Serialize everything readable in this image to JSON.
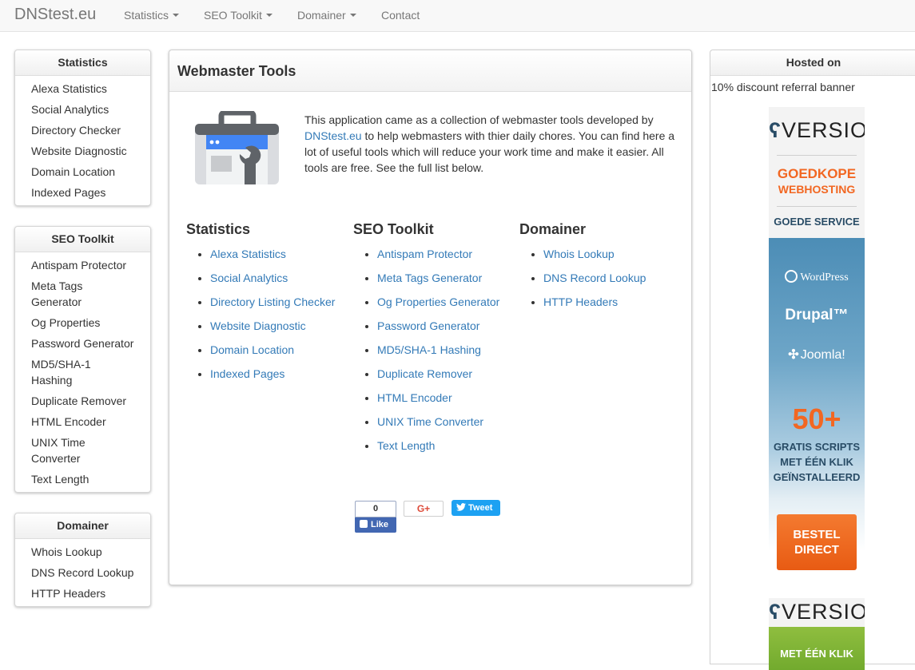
{
  "navbar": {
    "brand": "DNStest.eu",
    "items": [
      {
        "label": "Statistics"
      },
      {
        "label": "SEO Toolkit"
      },
      {
        "label": "Domainer"
      },
      {
        "label": "Contact"
      }
    ]
  },
  "sidebar": {
    "statistics": {
      "title": "Statistics",
      "items": [
        "Alexa Statistics",
        "Social Analytics",
        "Directory Checker",
        "Website Diagnostic",
        "Domain Location",
        "Indexed Pages"
      ]
    },
    "seo": {
      "title": "SEO Toolkit",
      "items": [
        "Antispam Protector",
        "Meta Tags Generator",
        "Og Properties",
        "Password Generator",
        "MD5/SHA-1 Hashing",
        "Duplicate Remover",
        "HTML Encoder",
        "UNIX Time Converter",
        "Text Length"
      ]
    },
    "domainer": {
      "title": "Domainer",
      "items": [
        "Whois Lookup",
        "DNS Record Lookup",
        "HTTP Headers"
      ]
    }
  },
  "main": {
    "title": "Webmaster Tools",
    "intro_before": "This application came as a collection of webmaster tools developed by ",
    "intro_link": "DNStest.eu",
    "intro_after": " to help webmasters with thier daily chores. You can find here a lot of useful tools which will reduce your work time and make it easier. All tools are free. See the full list below.",
    "columns": [
      {
        "title": "Statistics",
        "items": [
          "Alexa Statistics",
          "Social Analytics",
          "Directory Listing Checker",
          "Website Diagnostic",
          "Domain Location",
          "Indexed Pages"
        ]
      },
      {
        "title": "SEO Toolkit",
        "items": [
          "Antispam Protector",
          "Meta Tags Generator",
          "Og Properties Generator",
          "Password Generator",
          "MD5/SHA-1 Hashing",
          "Duplicate Remover",
          "HTML Encoder",
          "UNIX Time Converter",
          "Text Length"
        ]
      },
      {
        "title": "Domainer",
        "items": [
          "Whois Lookup",
          "DNS Record Lookup",
          "HTTP Headers"
        ]
      }
    ],
    "social": {
      "fb_count": "0",
      "fb_like": "Like",
      "gplus": "G+",
      "tweet": "Tweet"
    }
  },
  "hosted": {
    "title": "Hosted on",
    "note": "10% discount referral banner",
    "banner": {
      "logo": "VERSIO",
      "line1": "GOEDKOPE",
      "line2": "WEBHOSTING",
      "service": "GOEDE SERVICE",
      "cms": [
        "WordPress",
        "Drupal™",
        "Joomla!"
      ],
      "big": "50+",
      "scripts": [
        "GRATIS SCRIPTS",
        "MET ÉÉN KLIK",
        "GEÏNSTALLEERD"
      ],
      "button": [
        "BESTEL",
        "DIRECT"
      ]
    },
    "banner2": {
      "logo": "VERSIO",
      "strip": "MET ÉÉN KLIK"
    }
  },
  "colors": {
    "link": "#337ab7",
    "accent_orange": "#f26722",
    "banner_blue": "#4c8db6",
    "facebook": "#4267b2",
    "twitter": "#1da1f2"
  }
}
